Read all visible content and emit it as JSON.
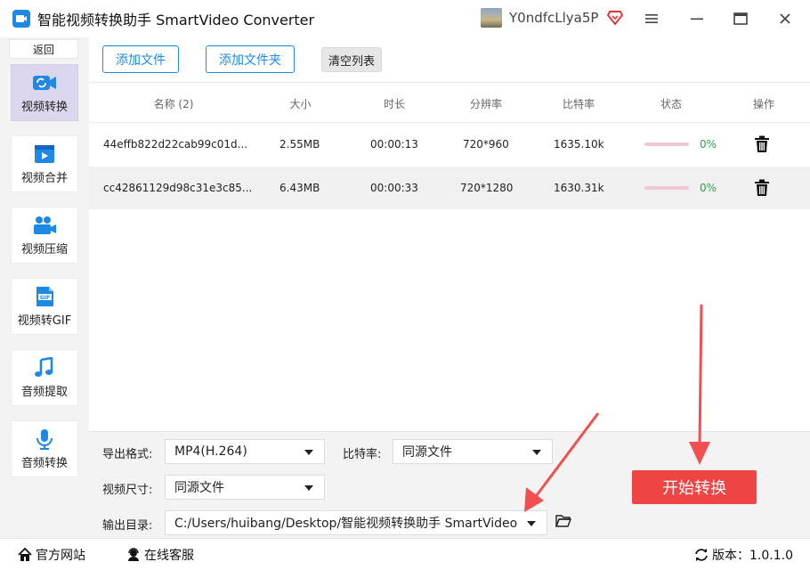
{
  "app": {
    "title": "智能视频转换助手 SmartVideo Converter",
    "user_name": "Y0ndfcLlya5P"
  },
  "sidebar": {
    "back_label": "返回",
    "items": [
      {
        "label": "视频转换",
        "icon": "video-convert-icon",
        "active": true
      },
      {
        "label": "视频合并",
        "icon": "video-merge-icon",
        "active": false
      },
      {
        "label": "视频压缩",
        "icon": "video-compress-icon",
        "active": false
      },
      {
        "label": "视频转GIF",
        "icon": "gif-icon",
        "active": false
      },
      {
        "label": "音频提取",
        "icon": "music-note-icon",
        "active": false
      },
      {
        "label": "音频转换",
        "icon": "microphone-icon",
        "active": false
      }
    ]
  },
  "toolbar": {
    "add_file": "添加文件",
    "add_folder": "添加文件夹",
    "clear_list": "清空列表"
  },
  "table": {
    "headers": {
      "name": "名称 (2)",
      "size": "大小",
      "duration": "时长",
      "resolution": "分辨率",
      "bitrate": "比特率",
      "status": "状态",
      "action": "操作"
    },
    "rows": [
      {
        "name": "44effb822d22cab99c01d...",
        "size": "2.55MB",
        "duration": "00:00:13",
        "resolution": "720*960",
        "bitrate": "1635.10k",
        "progress": "0%"
      },
      {
        "name": "cc42861129d98c31e3c85...",
        "size": "6.43MB",
        "duration": "00:00:33",
        "resolution": "720*1280",
        "bitrate": "1630.31k",
        "progress": "0%"
      }
    ]
  },
  "settings": {
    "format_label": "导出格式:",
    "format_value": "MP4(H.264)",
    "bitrate_label": "比特率:",
    "bitrate_value": "同源文件",
    "size_label": "视频尺寸:",
    "size_value": "同源文件",
    "output_label": "输出目录:",
    "output_value": "C:/Users/huibang/Desktop/智能视频转换助手 SmartVideo",
    "start_label": "开始转换"
  },
  "statusbar": {
    "website": "官方网站",
    "support": "在线客服",
    "version": "版本：1.0.1.0"
  },
  "colors": {
    "accent": "#1e88e5",
    "start_button": "#ef4444",
    "arrow": "#f05050",
    "progress_text": "#2aa24a"
  }
}
